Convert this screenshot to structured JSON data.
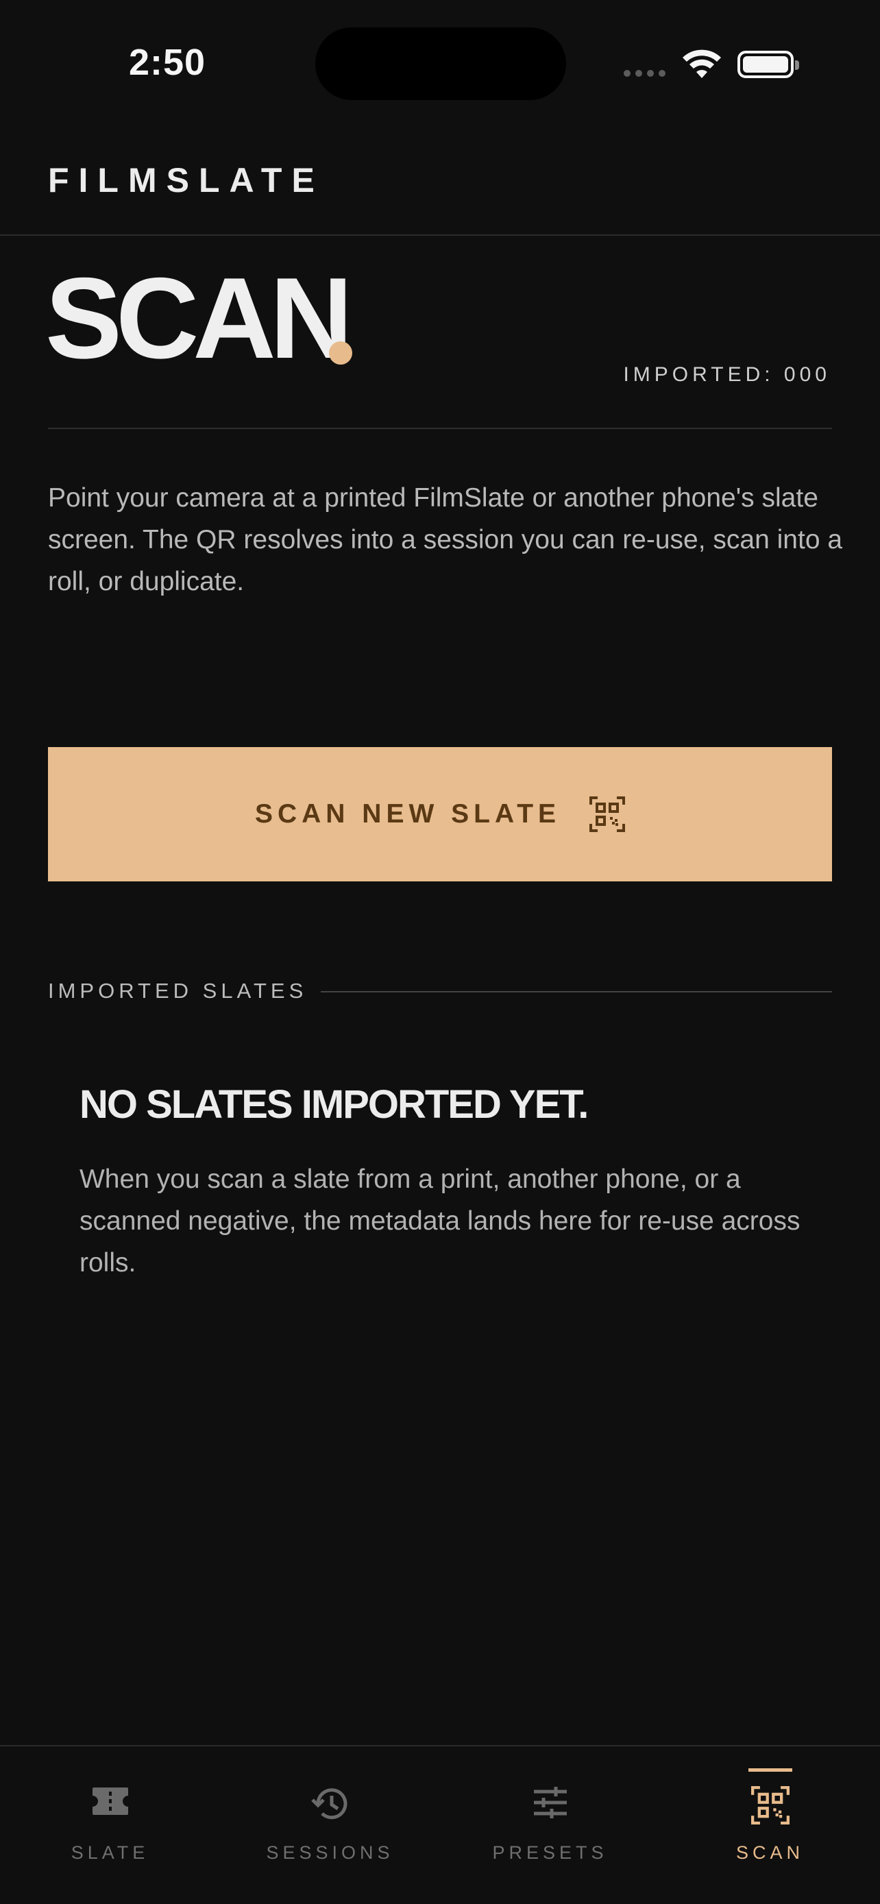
{
  "status_bar": {
    "time": "2:50"
  },
  "header": {
    "brand": "FILMSLATE"
  },
  "page": {
    "title": "SCAN",
    "imported_label": "IMPORTED: 000",
    "intro": "Point your camera at a printed FilmSlate or another phone's slate screen. The QR resolves into a session you can re-use, scan into a roll, or duplicate."
  },
  "scan_button": {
    "label": "SCAN NEW SLATE",
    "icon": "qr-code-icon"
  },
  "imported_section": {
    "label": "IMPORTED SLATES",
    "empty_title": "NO SLATES IMPORTED YET.",
    "empty_body": "When you scan a slate from a print, another phone, or a scanned negative, the metadata lands here for re-use across rolls."
  },
  "tabs": [
    {
      "label": "SLATE",
      "icon": "ticket-icon",
      "active": false
    },
    {
      "label": "SESSIONS",
      "icon": "history-icon",
      "active": false
    },
    {
      "label": "PRESETS",
      "icon": "sliders-icon",
      "active": false
    },
    {
      "label": "SCAN",
      "icon": "qr-code-icon",
      "active": true
    }
  ],
  "colors": {
    "accent": "#e8bb8c",
    "background": "#0f0f0f",
    "button_text": "#5a3914"
  }
}
